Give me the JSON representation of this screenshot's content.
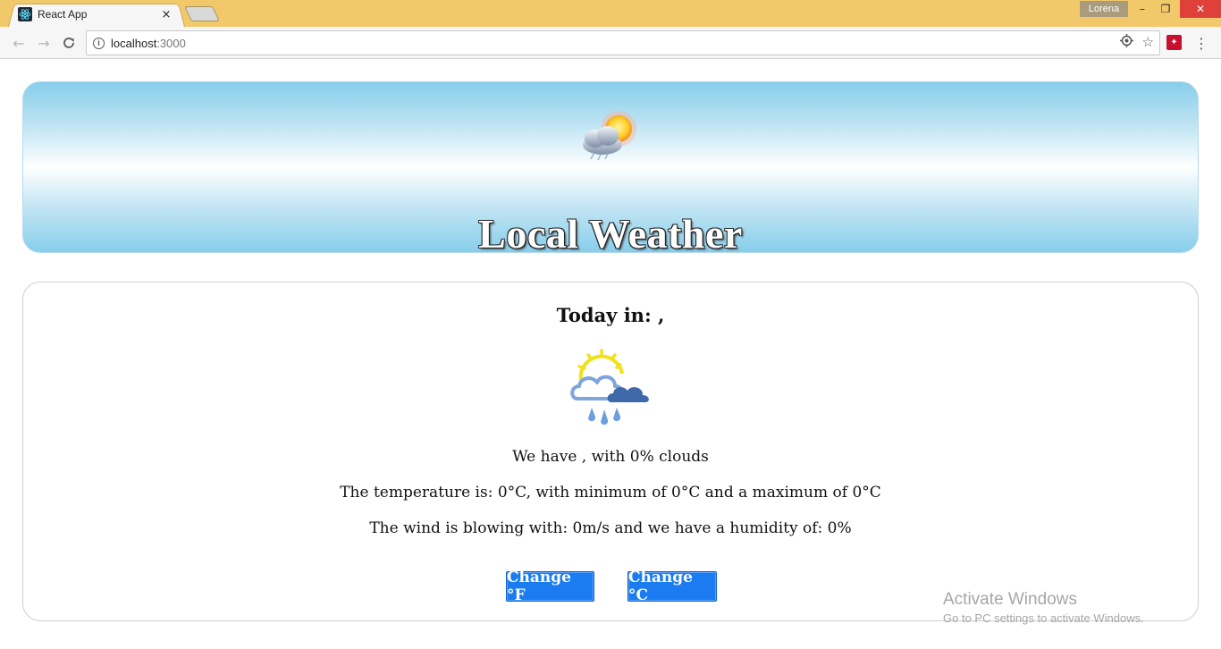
{
  "browser": {
    "tab_title": "React App",
    "tab_close": "×",
    "profile_name": "Lorena",
    "url_host": "localhost",
    "url_path": ":3000",
    "window_minimize": "–",
    "window_maximize": "❐",
    "window_close": "✕"
  },
  "icons": {
    "back": "back-arrow-icon",
    "forward": "forward-arrow-icon",
    "reload": "reload-icon",
    "info": "info-icon",
    "location": "location-target-icon",
    "bookmark": "star-icon",
    "extension": "extension-icon",
    "menu": "kebab-menu-icon",
    "header_weather": "partly-cloudy-sun-icon",
    "condition_weather": "sun-cloud-rain-icon"
  },
  "header": {
    "title": "Local Weather"
  },
  "weather": {
    "today_heading": "Today in: ,",
    "description_line": "We have , with 0% clouds",
    "temperature_line": "The temperature is: 0°C, with minimum of 0°C and a maximum of 0°C",
    "wind_line": "The wind is blowing with: 0m/s and we have a humidity of: 0%"
  },
  "buttons": {
    "fahrenheit": "Change °F",
    "celsius": "Change °C"
  },
  "watermark": {
    "title": "Activate Windows",
    "subtitle": "Go to PC settings to activate Windows."
  },
  "colors": {
    "titlebar": "#f2c96a",
    "button_blue": "#1a7cf0",
    "header_sky": "#87ceeb"
  }
}
